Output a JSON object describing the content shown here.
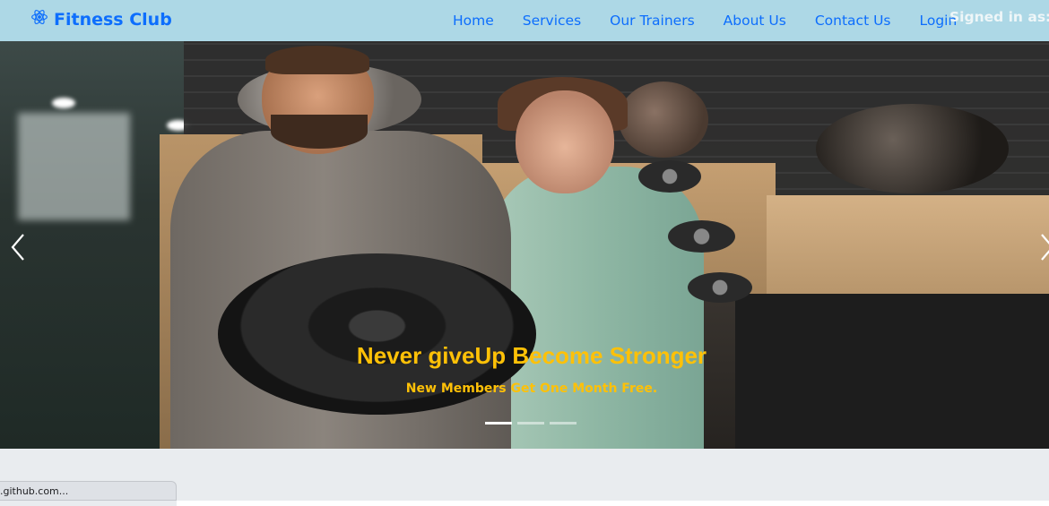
{
  "navbar": {
    "brand": "Fitness Club",
    "brand_icon": "atom-icon",
    "links": [
      "Home",
      "Services",
      "Our Trainers",
      "About Us",
      "Contact Us",
      "Login"
    ],
    "signed_in": "Signed in as:"
  },
  "carousel": {
    "caption_title": "Never giveUp Become Stronger",
    "caption_subtitle": "New Members Get One Month Free.",
    "slide_count": 3,
    "active_slide": 1,
    "prev_icon": "chevron-left-icon",
    "next_icon": "chevron-right-icon"
  },
  "status_bar": {
    "url_preview": ".github.com..."
  },
  "colors": {
    "navbar_bg": "#add8e6",
    "link": "#0d6efd",
    "caption": "#ffc107"
  }
}
